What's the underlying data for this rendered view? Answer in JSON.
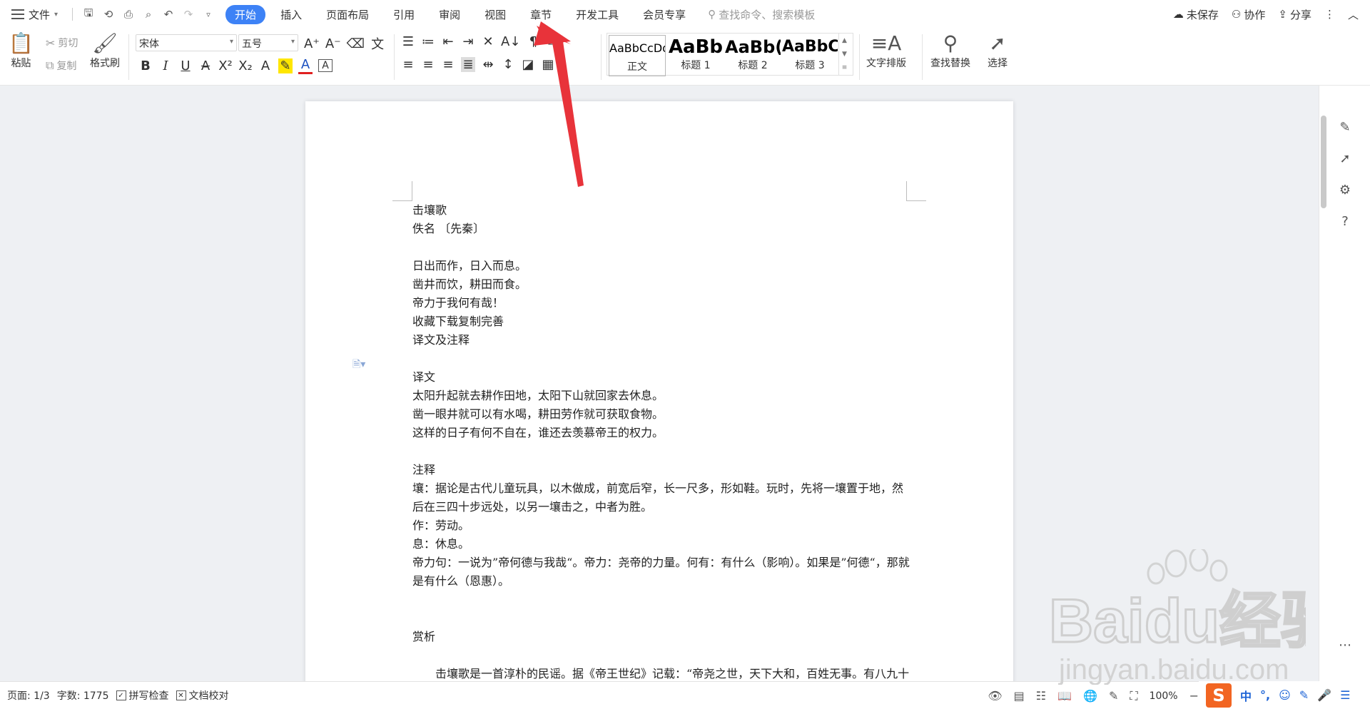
{
  "menu": {
    "file_label": "文件",
    "tabs": [
      "开始",
      "插入",
      "页面布局",
      "引用",
      "审阅",
      "视图",
      "章节",
      "开发工具",
      "会员专享"
    ],
    "active_tab": "开始",
    "search_placeholder": "查找命令、搜索模板",
    "right": {
      "unsaved": "未保存",
      "collab": "协作",
      "share": "分享"
    }
  },
  "ribbon": {
    "paste": "粘贴",
    "cut": "剪切",
    "copy": "复制",
    "format_painter": "格式刷",
    "font_name": "宋体",
    "font_size": "五号",
    "styles": [
      {
        "preview": "AaBbCcDd",
        "name": "正文"
      },
      {
        "preview": "AaBb",
        "name": "标题 1"
      },
      {
        "preview": "AaBb(",
        "name": "标题 2"
      },
      {
        "preview": "AaBbC",
        "name": "标题 3"
      }
    ],
    "text_layout": "文字排版",
    "find_replace": "查找替换",
    "select": "选择"
  },
  "document": {
    "paragraphs": [
      "击壤歌",
      "佚名 〔先秦〕",
      "",
      "日出而作，日入而息。",
      "凿井而饮，耕田而食。",
      "帝力于我何有哉！",
      "收藏下载复制完善",
      "译文及注释",
      "",
      "译文",
      "太阳升起就去耕作田地，太阳下山就回家去休息。",
      "凿一眼井就可以有水喝，耕田劳作就可获取食物。",
      "这样的日子有何不自在，谁还去羡慕帝王的权力。",
      "",
      "注释",
      "壤：据论是古代儿童玩具，以木做成，前宽后窄，长一尺多，形如鞋。玩时，先将一壤置于地，然后在三四十步远处，以另一壤击之，中者为胜。",
      "作：劳动。",
      "息：休息。",
      "帝力句：一说为”帝何德与我哉“。帝力：尧帝的力量。何有：有什么（影响）。如果是”何德“，那就是有什么（恩惠）。",
      "",
      "",
      "赏析",
      "",
      "击壤歌是一首淳朴的民谣。据《帝王世纪》记载：“帝尧之世，天下大和，百姓无事。有八九十老人，击壤而歌。”这位八九十岁的老人所歌的歌词就是：“日出而作，日入而息。"
    ]
  },
  "status": {
    "page": "页面: 1/3",
    "words": "字数: 1775",
    "spell_check": "拼写检查",
    "doc_proof": "文档校对",
    "zoom": "100%"
  },
  "ime": {
    "lang": "中"
  },
  "watermark": {
    "brand": "Baidu经验",
    "url": "jingyan.baidu.com"
  },
  "colors": {
    "active_tab": "#3d82f6",
    "arrow": "#e8333a",
    "ime_logo": "#f26522"
  }
}
